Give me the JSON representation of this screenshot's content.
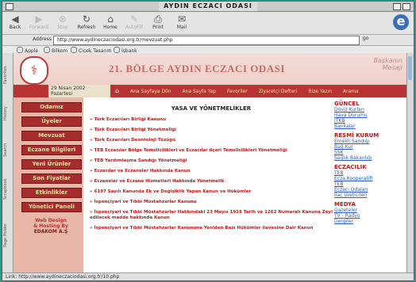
{
  "window": {
    "title": "AYDIN ECZACI ODASI"
  },
  "toolbar": {
    "buttons": [
      {
        "label": "Back",
        "icon": "back-arrow-icon",
        "enabled": true
      },
      {
        "label": "Forward",
        "icon": "forward-arrow-icon",
        "enabled": false
      },
      {
        "label": "Stop",
        "icon": "stop-icon",
        "enabled": false
      },
      {
        "label": "Refresh",
        "icon": "refresh-icon",
        "enabled": true
      },
      {
        "label": "Home",
        "icon": "home-icon",
        "enabled": true
      },
      {
        "label": "AutoFill",
        "icon": "autofill-icon",
        "enabled": false
      },
      {
        "label": "Print",
        "icon": "print-icon",
        "enabled": true
      },
      {
        "label": "Mail",
        "icon": "mail-icon",
        "enabled": true
      }
    ]
  },
  "address": {
    "label": "Address",
    "url": "http://www.aydineczaciodasi.org.tr/mevzuat.php",
    "go": "go"
  },
  "favorites": [
    "Apple",
    "Bilkom",
    "Çiçek Tasarım",
    "İşbank"
  ],
  "sidetabs": [
    "Favorites",
    "History",
    "Search",
    "Scrapbook",
    "Page Holder"
  ],
  "status": {
    "text": "Link: http://www.aydineczaciodasi.org.tr/10.php"
  },
  "site": {
    "title": "21. BÖLGE AYDIN ECZACI ODASI",
    "brand_line1": "Başkanın",
    "brand_line2": "Mesajı",
    "date": "29 Nisan 2002",
    "day": "Pazartesi",
    "nav": [
      "Ana Sayfaya Dön",
      "Ana Sayfa Yap",
      "Favoriler",
      "Ziyaretçi Defteri",
      "Bize Yazın",
      "Arama"
    ]
  },
  "menu": {
    "items": [
      "Odamız",
      "Üyeler",
      "Mevzuat",
      "Eczane Bilgileri",
      "Yeni Ürünler",
      "Son Fiyatlar",
      "Etkinlikler",
      "Yönetici Paneli"
    ]
  },
  "credit": {
    "line1": "Web Design",
    "line2": "& Hosting By",
    "line3": "EDAKOM A.Ş"
  },
  "main": {
    "title": "YASA VE YÖNETMELİKLER",
    "links": [
      "Türk Eczacıları Birliği Kanunu",
      "Türk Eczacıları Birliği Yönetmeliği",
      "Türk Eczacıları Deontoloji Tüzüğü",
      "TEB Eczacılar Bölge Temsilcilikleri ve Eczacılar ilçeri Temsilcilikleri Yönetmeliği",
      "TEB Yardımlaşma Sandığı Yönetmeliği",
      "Eczacılar ve Eczaneler Hakkında Kanun",
      "Eczaneler ve Eczane Hizmetleri Hakkında Yönetmelik",
      "6197 Sayılı Kanunda Ek ve Değişiklik Yapan Kanun ve Hükümler",
      "İspençiyari ve Tıbbi Müstahzarlar Kanunu",
      "İspençiyari ve Tıbbi Müstahzarlar Hakkındaki 23 Mayıs 1928 Tarih ve 1262 Numaralı Kanuna Zeyl edilecek madde hakkında Kanun",
      "İspençiyari ve Tıbbi Müstahzarlar Kanununa Yeniden Bazı Hükümler ilavesine Dair Kanun"
    ]
  },
  "right": {
    "sections": [
      {
        "head": "GÜNCEL",
        "items": [
          "Döviz Kurları",
          "Hava Durumu",
          "İTKB",
          "Bankalar"
        ]
      },
      {
        "head": "RESMİ KURUM",
        "items": [
          "Emekli Sandığı",
          "Bağ-Kur",
          "SSK",
          "Sağlık Bakanlığı"
        ]
      },
      {
        "head": "ECZACILIK",
        "items": [
          "TEB",
          "Ecza Kooperatifi",
          "TEB",
          "Eczacı Odaları",
          "İlaç Üreticileri"
        ]
      },
      {
        "head": "MEDYA",
        "items": [
          "Gazeteler",
          "TV - Radyo",
          "Dergiler"
        ]
      }
    ]
  },
  "colors": {
    "brand_red": "#b93333",
    "menu_bg": "#a62d2d",
    "menu_text": "#f7e3a0",
    "link": "#c01818",
    "page_bg": "#2e9a8e"
  }
}
